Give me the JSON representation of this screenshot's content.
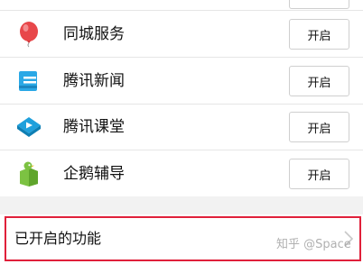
{
  "rows": [
    {
      "label": "同城服务",
      "button": "开启",
      "icon": "balloon-icon"
    },
    {
      "label": "腾讯新闻",
      "button": "开启",
      "icon": "news-icon"
    },
    {
      "label": "腾讯课堂",
      "button": "开启",
      "icon": "classroom-icon"
    },
    {
      "label": "企鹅辅导",
      "button": "开启",
      "icon": "penguin-tutor-icon"
    }
  ],
  "enabled_section": {
    "label": "已开启的功能"
  },
  "watermark": "知乎 @Space",
  "colors": {
    "highlight_border": "#e0203a",
    "balloon": "#e8474a",
    "news": "#2aa8e6",
    "classroom": "#1fa0dc",
    "penguin": "#7cc242"
  }
}
